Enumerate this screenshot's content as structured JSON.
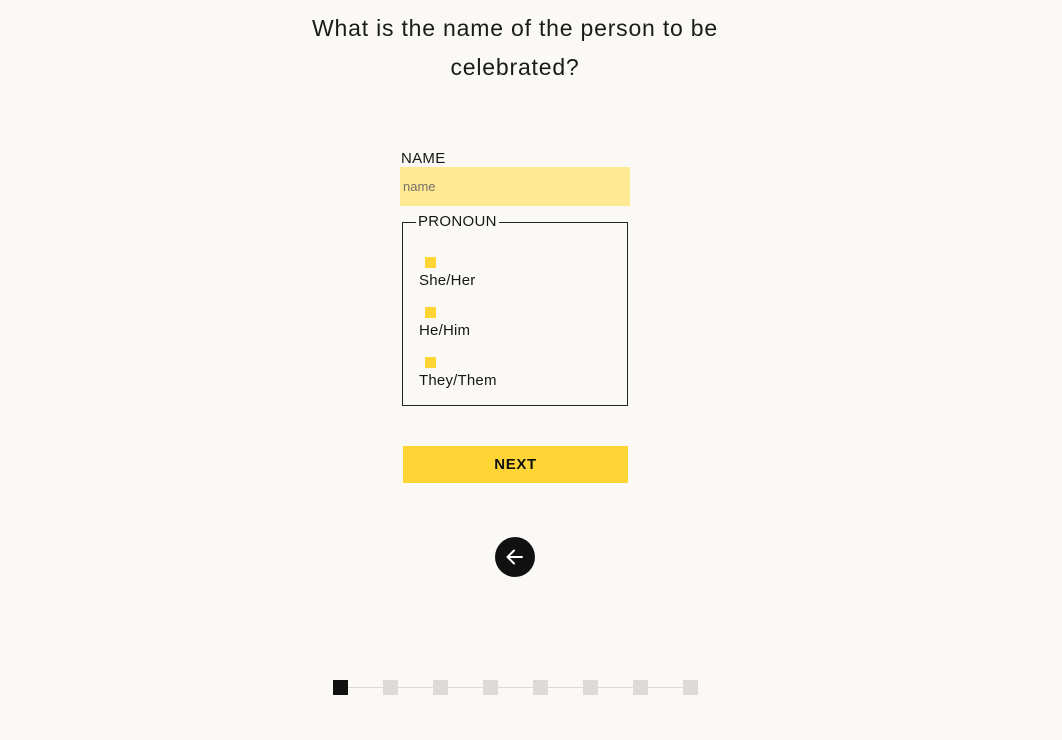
{
  "question": "What is the name of the person to be celebrated?",
  "name_field": {
    "label": "NAME",
    "placeholder": "name",
    "value": ""
  },
  "pronoun": {
    "legend": "PRONOUN",
    "options": [
      {
        "label": "She/Her",
        "selected": false
      },
      {
        "label": "He/Him",
        "selected": false
      },
      {
        "label": "They/Them",
        "selected": false
      }
    ]
  },
  "next_label": "NEXT",
  "back_icon": "arrow-left-icon",
  "progress": {
    "current_step": 1,
    "total_steps": 8
  },
  "colors": {
    "background": "#faf9f5",
    "accent": "#fed535",
    "input_fill": "#ffe993",
    "dark": "#111111",
    "step_inactive": "#dcdbd9"
  }
}
